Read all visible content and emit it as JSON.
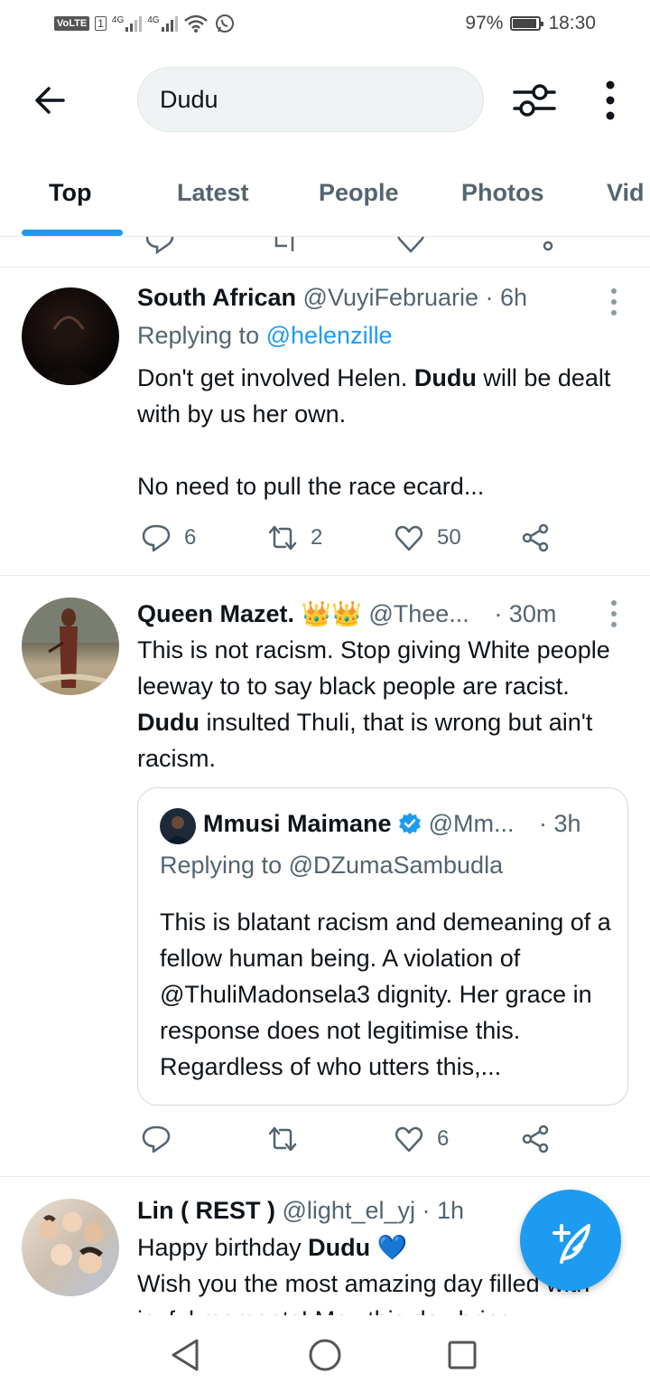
{
  "status_bar": {
    "volte": "VoLTE",
    "sim": "1",
    "net1": "4G",
    "net2": "4G",
    "battery": "97%",
    "time": "18:30"
  },
  "search": {
    "query": "Dudu"
  },
  "tabs": [
    {
      "label": "Top",
      "active": true
    },
    {
      "label": "Latest",
      "active": false
    },
    {
      "label": "People",
      "active": false
    },
    {
      "label": "Photos",
      "active": false
    },
    {
      "label": "Vid",
      "active": false
    }
  ],
  "tweets": [
    {
      "name": "South African",
      "handle": "@VuyiFebruarie",
      "time": "· 6h",
      "replying_prefix": "Replying to ",
      "replying_handle": "@helenzille",
      "body_1a": "Don't get involved Helen. ",
      "body_1b": "Dudu",
      "body_1c": " will be dealt with by us her own.",
      "body_2": "No need to pull the race ecard...",
      "replies": "6",
      "retweets": "2",
      "likes": "50"
    },
    {
      "name": "Queen Mazet.",
      "crowns": "👑👑",
      "handle": "@Thee...",
      "time": "· 30m",
      "body_a": "This is not racism. Stop giving White people leeway to to say black people are racist. ",
      "body_b": "Dudu",
      "body_c": " insulted Thuli, that is wrong but ain't racism.",
      "quote": {
        "name": "Mmusi Maimane",
        "handle": "@Mm...",
        "time": "· 3h",
        "replying": "Replying to @DZumaSambudla",
        "body": "This is blatant racism and demeaning of a fellow human being. A violation of @ThuliMadonsela3 dignity. Her grace in response does not legitimise this. Regardless of who utters this,..."
      },
      "replies": "",
      "retweets": "",
      "likes": "6"
    },
    {
      "name": "Lin ( REST )",
      "handle": "@light_el_yj",
      "time": "· 1h",
      "body_a": "Happy birthday ",
      "body_b": "Dudu",
      "body_c": " 💙",
      "body_2": "Wish you the most amazing day filled with joyful moments! May this day bring"
    }
  ],
  "colors": {
    "accent": "#1d9bf0",
    "text": "#0f1419",
    "muted": "#536471"
  }
}
